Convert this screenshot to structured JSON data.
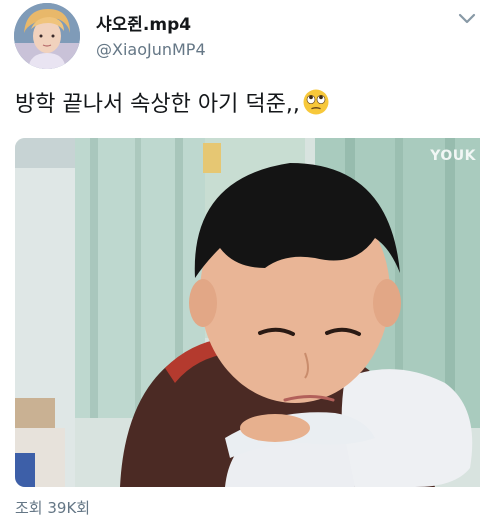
{
  "tweet": {
    "display_name": "샤오쥔.mp4",
    "handle": "@XiaoJunMP4",
    "text": "방학 끝나서 속상한 아기 덕준,,",
    "emoji_icon": "face-with-rolling-eyes-icon",
    "media": {
      "description_icon": "video-thumbnail",
      "watermark": "YOUK"
    },
    "views": "조회 39K회"
  },
  "colors": {
    "text_primary": "#14171a",
    "text_secondary": "#657786",
    "background": "#ffffff"
  }
}
